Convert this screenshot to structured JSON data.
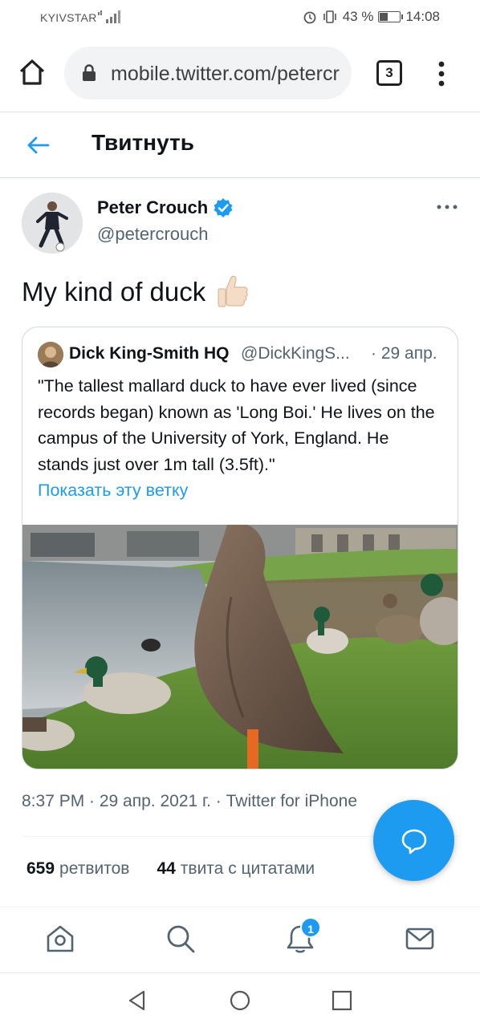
{
  "status_bar": {
    "carrier": "KYIVSTAR",
    "battery": "43 %",
    "battery_level": 0.43,
    "time": "14:08"
  },
  "browser": {
    "url": "mobile.twitter.com/petercrouch",
    "tab_count": "3"
  },
  "header": {
    "title": "Твитнуть"
  },
  "tweet": {
    "author_name": "Peter Crouch",
    "author_handle": "@petercrouch",
    "text": "My kind of duck",
    "meta": "8:37 PM · 29 апр. 2021 г. · Twitter for iPhone",
    "stats": {
      "retweets_count": "659",
      "retweets_label": "ретвитов",
      "quotes_count": "44",
      "quotes_label": "твита с цитатами"
    }
  },
  "quoted_tweet": {
    "author_name": "Dick King-Smith HQ",
    "author_handle": "@DickKingS...",
    "date": "· 29 апр.",
    "text": "\"The tallest mallard duck to have ever lived (since records began) known as 'Long Boi.' He lives on the campus of the University of York, England. He stands just over 1m tall (3.5ft).\"",
    "thread_link": "Показать эту ветку"
  },
  "bottom_nav": {
    "notification_badge": "1"
  },
  "colors": {
    "accent": "#1d9bf0",
    "text_primary": "#0f1419",
    "text_secondary": "#536471"
  }
}
